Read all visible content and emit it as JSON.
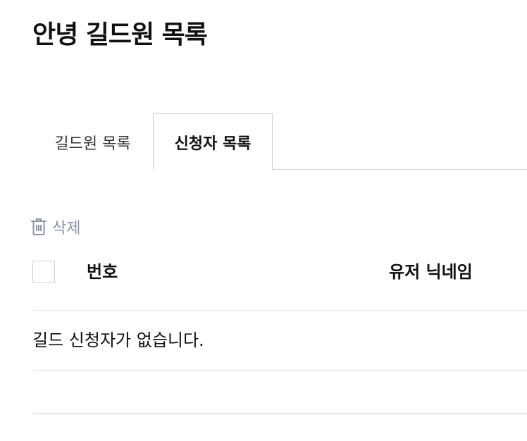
{
  "page": {
    "title": "안녕 길드원 목록"
  },
  "tabs": [
    {
      "label": "길드원 목록",
      "active": false
    },
    {
      "label": "신청자 목록",
      "active": true
    }
  ],
  "actions": {
    "delete_label": "삭제",
    "delete_icon": "trash-icon"
  },
  "table": {
    "columns": [
      "번호",
      "유저 닉네임"
    ],
    "empty_message": "길드 신청자가 없습니다."
  },
  "colors": {
    "text": "#111111",
    "muted_action": "#8b93a5",
    "border": "#cfcfcf",
    "divider": "#e4e4e4"
  }
}
